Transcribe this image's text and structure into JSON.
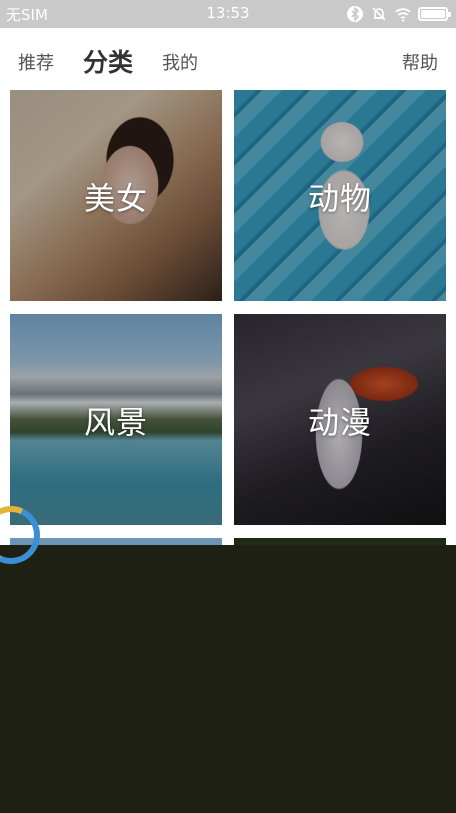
{
  "statusbar": {
    "carrier": "无SIM",
    "time": "13:53",
    "icons": [
      "bluetooth-icon",
      "alarm-off-icon",
      "wifi-icon",
      "battery-icon"
    ],
    "battery_level": 1.0
  },
  "tabs": {
    "recommend": "推荐",
    "category": "分类",
    "mine": "我的",
    "help": "帮助",
    "active": "category"
  },
  "categories": [
    {
      "label": "美女",
      "theme": "portrait"
    },
    {
      "label": "动物",
      "theme": "kitten"
    },
    {
      "label": "风景",
      "theme": "lake-mountains"
    },
    {
      "label": "动漫",
      "theme": "anime-character"
    }
  ],
  "loading": {
    "spinner_colors": [
      "#e3b33a",
      "#3a8fd6",
      "#e97aa0"
    ]
  },
  "colors": {
    "statusbar_bg": "#c9c9c9",
    "overlay_bg": "#1e2014",
    "label_text": "#ffffff"
  }
}
